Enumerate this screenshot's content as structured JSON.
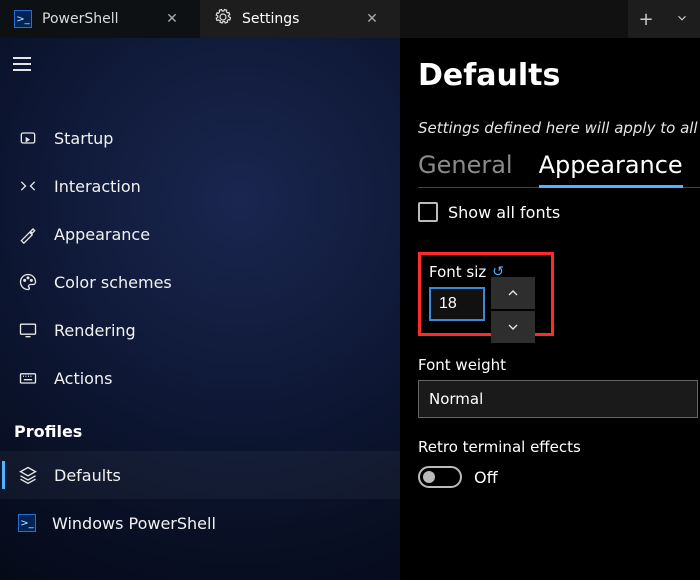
{
  "tabs": {
    "inactive": {
      "label": "PowerShell"
    },
    "active": {
      "label": "Settings"
    }
  },
  "sidebar": {
    "items": [
      {
        "label": "Startup"
      },
      {
        "label": "Interaction"
      },
      {
        "label": "Appearance"
      },
      {
        "label": "Color schemes"
      },
      {
        "label": "Rendering"
      },
      {
        "label": "Actions"
      }
    ],
    "profiles_header": "Profiles",
    "profiles": [
      {
        "label": "Defaults"
      },
      {
        "label": "Windows PowerShell"
      }
    ]
  },
  "content": {
    "title": "Defaults",
    "subtitle": "Settings defined here will apply to all p",
    "tabs": {
      "general": "General",
      "appearance": "Appearance"
    },
    "show_all_fonts": "Show all fonts",
    "font_size": {
      "label": "Font siz",
      "value": "18"
    },
    "font_weight": {
      "label": "Font weight",
      "value": "Normal"
    },
    "retro": {
      "label": "Retro terminal effects",
      "state": "Off"
    }
  }
}
